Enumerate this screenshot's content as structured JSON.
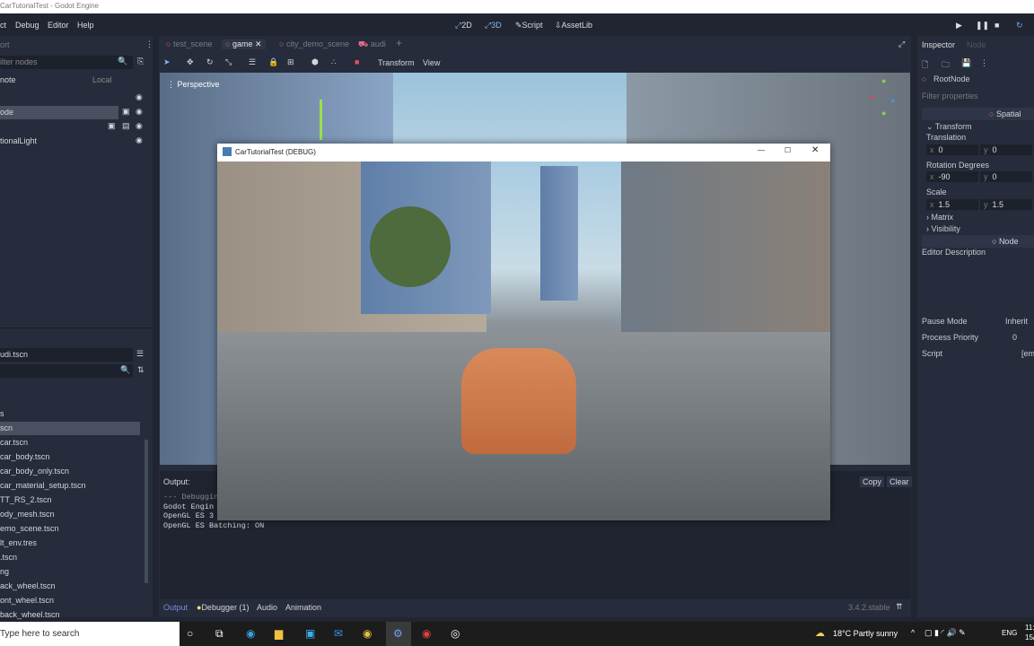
{
  "window": {
    "title": "CarTutorialTest - Godot Engine"
  },
  "menu": [
    "ct",
    "Debug",
    "Editor",
    "Help"
  ],
  "workspaces": [
    "2D",
    "3D",
    "Script",
    "AssetLib"
  ],
  "scene_dock": {
    "tab": "ort",
    "filter_placeholder": "ilter nodes",
    "remote": "note",
    "local": "Local",
    "nodes": [
      "",
      "ode",
      "",
      "tionalLight"
    ]
  },
  "filesystem": {
    "path": "udi.tscn",
    "files": [
      "s",
      "scn",
      "car.tscn",
      "car_body.tscn",
      "car_body_only.tscn",
      "car_material_setup.tscn",
      "TT_RS_2.tscn",
      "ody_mesh.tscn",
      "emo_scene.tscn",
      "lt_env.tres",
      ".tscn",
      "ng",
      "ack_wheel.tscn",
      "ont_wheel.tscn",
      "back_wheel.tscn"
    ]
  },
  "scene_tabs": [
    "test_scene",
    "game",
    "city_demo_scene",
    "audi"
  ],
  "toolbar": {
    "transform": "Transform",
    "view": "View"
  },
  "viewport": {
    "label": "Perspective"
  },
  "output": {
    "title": "Output:",
    "copy": "Copy",
    "clear": "Clear",
    "lines": [
      "--- Debugging",
      "Godot Engin",
      "OpenGL ES 3",
      "OpenGL ES Batching: ON"
    ]
  },
  "bottom_tabs": [
    "Output",
    "Debugger (1)",
    "Audio",
    "Animation"
  ],
  "version": "3.4.2.stable",
  "inspector": {
    "tabs": [
      "Inspector",
      "Node"
    ],
    "node": "RootNode",
    "filter": "Filter properties",
    "spatial": "Spatial",
    "transform": "Transform",
    "translation": "Translation",
    "translation_vals": [
      "0",
      "0"
    ],
    "rotation": "Rotation Degrees",
    "rotation_vals": [
      "-90",
      "0"
    ],
    "scale": "Scale",
    "scale_vals": [
      "1.5",
      "1.5"
    ],
    "matrix": "Matrix",
    "visibility": "Visibility",
    "node_section": "Node",
    "editor_desc": "Editor Description",
    "pause_mode": "Pause Mode",
    "pause_val": "Inherit",
    "priority": "Process Priority",
    "priority_val": "0",
    "script": "Script",
    "script_val": "[em"
  },
  "game_window": {
    "title": "CarTutorialTest (DEBUG)"
  },
  "taskbar": {
    "search": "Type here to search",
    "weather": "18°C  Partly sunny",
    "lang": "ENG",
    "time": "11:",
    "date": "15/"
  }
}
